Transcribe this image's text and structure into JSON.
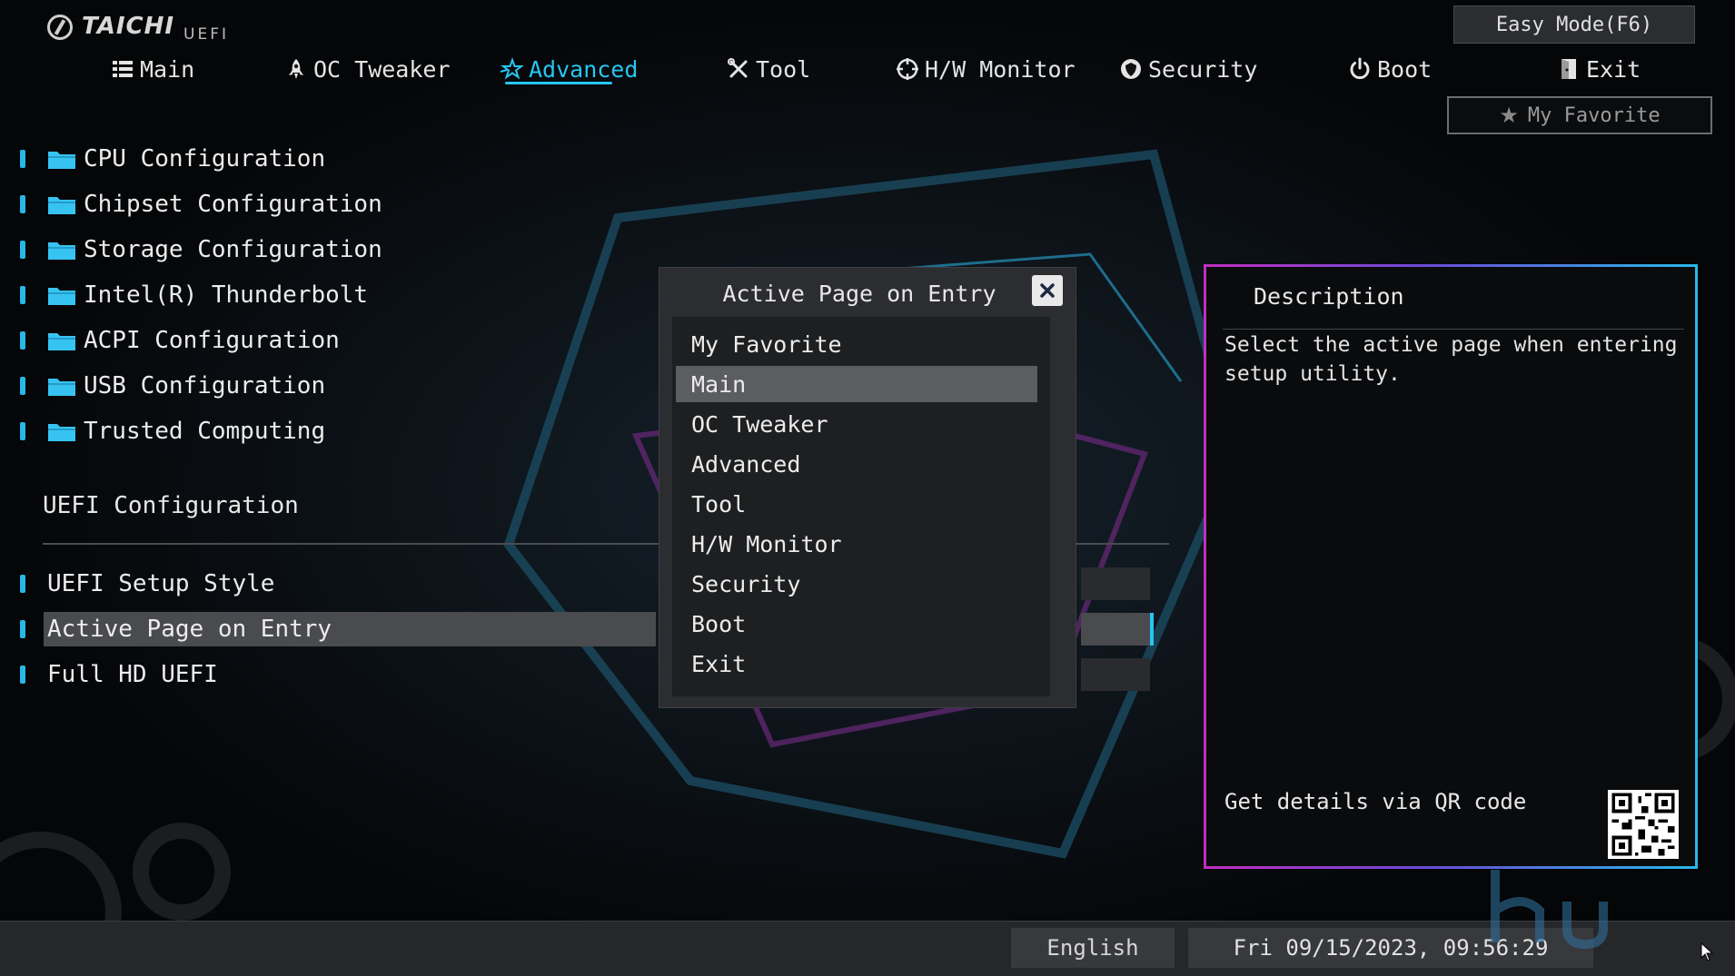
{
  "header": {
    "brand": "TAICHI",
    "brand_sub": "UEFI",
    "easy_mode_label": "Easy Mode(F6)",
    "favorite_label": "My Favorite"
  },
  "nav": {
    "tabs": [
      {
        "label": "Main",
        "icon": "list-icon"
      },
      {
        "label": "OC Tweaker",
        "icon": "rocket-icon"
      },
      {
        "label": "Advanced",
        "icon": "star-icon",
        "active": true
      },
      {
        "label": "Tool",
        "icon": "tools-icon"
      },
      {
        "label": "H/W Monitor",
        "icon": "crosshair-icon"
      },
      {
        "label": "Security",
        "icon": "shield-icon"
      },
      {
        "label": "Boot",
        "icon": "power-icon"
      },
      {
        "label": "Exit",
        "icon": "exit-door-icon"
      }
    ],
    "active_color": "#27c5f0"
  },
  "menu": {
    "items": [
      {
        "label": "CPU Configuration"
      },
      {
        "label": "Chipset Configuration"
      },
      {
        "label": "Storage Configuration"
      },
      {
        "label": "Intel(R) Thunderbolt"
      },
      {
        "label": "ACPI Configuration"
      },
      {
        "label": "USB Configuration"
      },
      {
        "label": "Trusted Computing"
      }
    ]
  },
  "uefi_section": {
    "title": "UEFI Configuration",
    "settings": [
      {
        "label": "UEFI Setup Style"
      },
      {
        "label": "Active Page on Entry",
        "selected": true
      },
      {
        "label": "Full HD UEFI"
      }
    ]
  },
  "dialog": {
    "title": "Active Page on Entry",
    "options": [
      {
        "label": "My Favorite"
      },
      {
        "label": "Main",
        "selected": true
      },
      {
        "label": "OC Tweaker"
      },
      {
        "label": "Advanced"
      },
      {
        "label": "Tool"
      },
      {
        "label": "H/W Monitor"
      },
      {
        "label": "Security"
      },
      {
        "label": "Boot"
      },
      {
        "label": "Exit"
      }
    ]
  },
  "description": {
    "title": "Description",
    "text": "Select the active page when entering setup utility.",
    "qr_label": "Get details via QR code"
  },
  "footer": {
    "language": "English",
    "datetime": "Fri 09/15/2023, 09:56:29"
  },
  "colors": {
    "accent": "#27c5f0",
    "border_pink": "#c02ec0",
    "background": "#050608"
  }
}
